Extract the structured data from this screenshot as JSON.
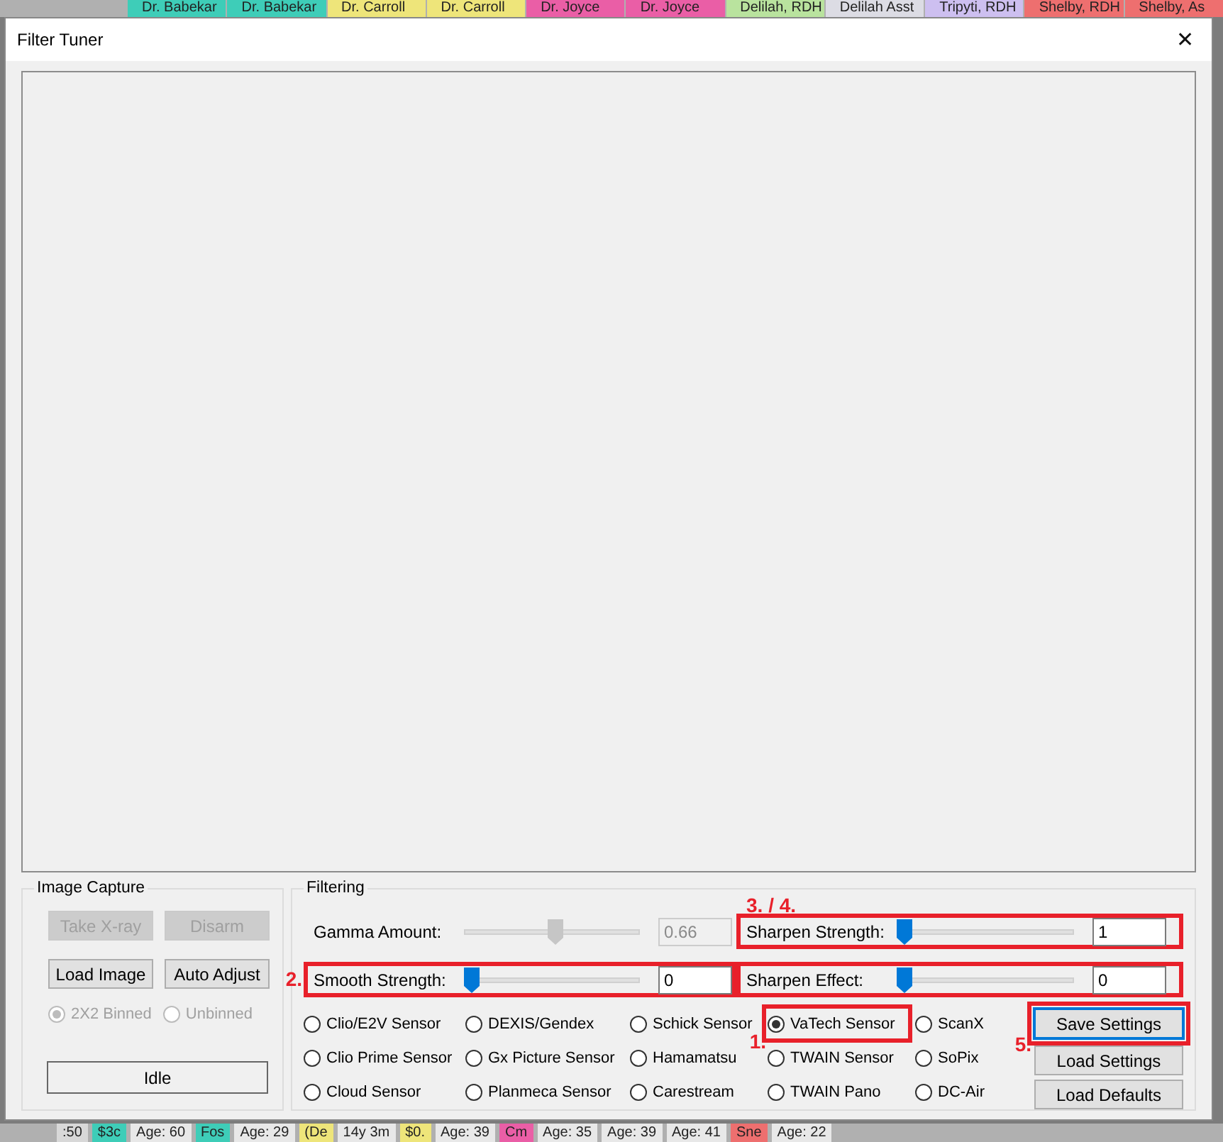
{
  "background_app": {
    "header_columns": [
      {
        "label": "Dr. Babekar",
        "color": "#3ecdb8"
      },
      {
        "label": "Dr. Babekar",
        "color": "#3ecdb8"
      },
      {
        "label": "Dr. Carroll",
        "color": "#eee57a"
      },
      {
        "label": "Dr. Carroll",
        "color": "#eee57a"
      },
      {
        "label": "Dr. Joyce",
        "color": "#ea5ea6"
      },
      {
        "label": "Dr. Joyce",
        "color": "#ea5ea6"
      },
      {
        "label": "Delilah, RDH",
        "color": "#b9e39e"
      },
      {
        "label": "Delilah Asst",
        "color": "#dcdce4"
      },
      {
        "label": "Tripyti, RDH",
        "color": "#cdbff0"
      },
      {
        "label": "Shelby, RDH",
        "color": "#ee6f6f"
      },
      {
        "label": "Shelby, As",
        "color": "#ee6f6f"
      }
    ],
    "footer_cells": [
      {
        "label": ":50",
        "color": "#d8d8d8"
      },
      {
        "label": "$3c",
        "color": "#3ecdb8"
      },
      {
        "label": "Age: 60",
        "color": "#e8e8e8"
      },
      {
        "label": "Fos",
        "color": "#3ecdb8"
      },
      {
        "label": "Age: 29",
        "color": "#e8e8e8"
      },
      {
        "label": "(De",
        "color": "#eee57a"
      },
      {
        "label": "14y 3m",
        "color": "#e8e8e8"
      },
      {
        "label": "$0.",
        "color": "#eee57a"
      },
      {
        "label": "Age: 39",
        "color": "#e8e8e8"
      },
      {
        "label": "Cm",
        "color": "#ea5ea6"
      },
      {
        "label": "Age: 35",
        "color": "#e8e8e8"
      },
      {
        "label": "Age: 39",
        "color": "#e8e8e8"
      },
      {
        "label": "Age: 41",
        "color": "#e8e8e8"
      },
      {
        "label": "Sne",
        "color": "#ee6f6f"
      },
      {
        "label": "Age: 22",
        "color": "#e8e8e8"
      }
    ]
  },
  "window": {
    "title": "Filter Tuner",
    "close": "✕"
  },
  "image_capture": {
    "title": "Image Capture",
    "buttons": [
      {
        "label": "Take X-ray",
        "disabled": true
      },
      {
        "label": "Disarm",
        "disabled": true
      },
      {
        "label": "Load Image",
        "disabled": false
      },
      {
        "label": "Auto Adjust",
        "disabled": false
      }
    ],
    "binning": [
      {
        "label": "2X2 Binned",
        "selected": true,
        "disabled": true
      },
      {
        "label": "Unbinned",
        "selected": false,
        "disabled": true
      }
    ],
    "status": "Idle"
  },
  "filtering": {
    "title": "Filtering",
    "sliders": [
      {
        "label": "Gamma Amount:",
        "level": 0.52,
        "value": "0.66",
        "disabled": true
      },
      {
        "label": "Sharpen Strength:",
        "level": 0,
        "value": "1",
        "disabled": false,
        "highlighted": true,
        "note": "3. / 4."
      },
      {
        "label": "Smooth Strength:",
        "level": 0,
        "value": "0",
        "disabled": false,
        "highlighted": true,
        "note": "2."
      },
      {
        "label": "Sharpen Effect:",
        "level": 0,
        "value": "0",
        "disabled": false,
        "highlighted": true
      }
    ],
    "sensors": [
      {
        "label": "Clio/E2V Sensor",
        "selected": false
      },
      {
        "label": "DEXIS/Gendex",
        "selected": false
      },
      {
        "label": "Schick Sensor",
        "selected": false
      },
      {
        "label": "VaTech Sensor",
        "selected": true,
        "highlighted": true,
        "note": "1."
      },
      {
        "label": "ScanX",
        "selected": false
      },
      {
        "label": "Clio Prime Sensor",
        "selected": false
      },
      {
        "label": "Gx Picture Sensor",
        "selected": false
      },
      {
        "label": "Hamamatsu",
        "selected": false
      },
      {
        "label": "TWAIN Sensor",
        "selected": false
      },
      {
        "label": "SoPix",
        "selected": false
      },
      {
        "label": "Cloud Sensor",
        "selected": false
      },
      {
        "label": "Planmeca Sensor",
        "selected": false
      },
      {
        "label": "Carestream",
        "selected": false
      },
      {
        "label": "TWAIN Pano",
        "selected": false
      },
      {
        "label": "DC-Air",
        "selected": false
      }
    ],
    "buttons": [
      {
        "label": "Save Settings",
        "focused": true,
        "highlighted": true,
        "note": "5."
      },
      {
        "label": "Load Settings",
        "focused": false
      },
      {
        "label": "Load Defaults",
        "focused": false
      }
    ]
  }
}
